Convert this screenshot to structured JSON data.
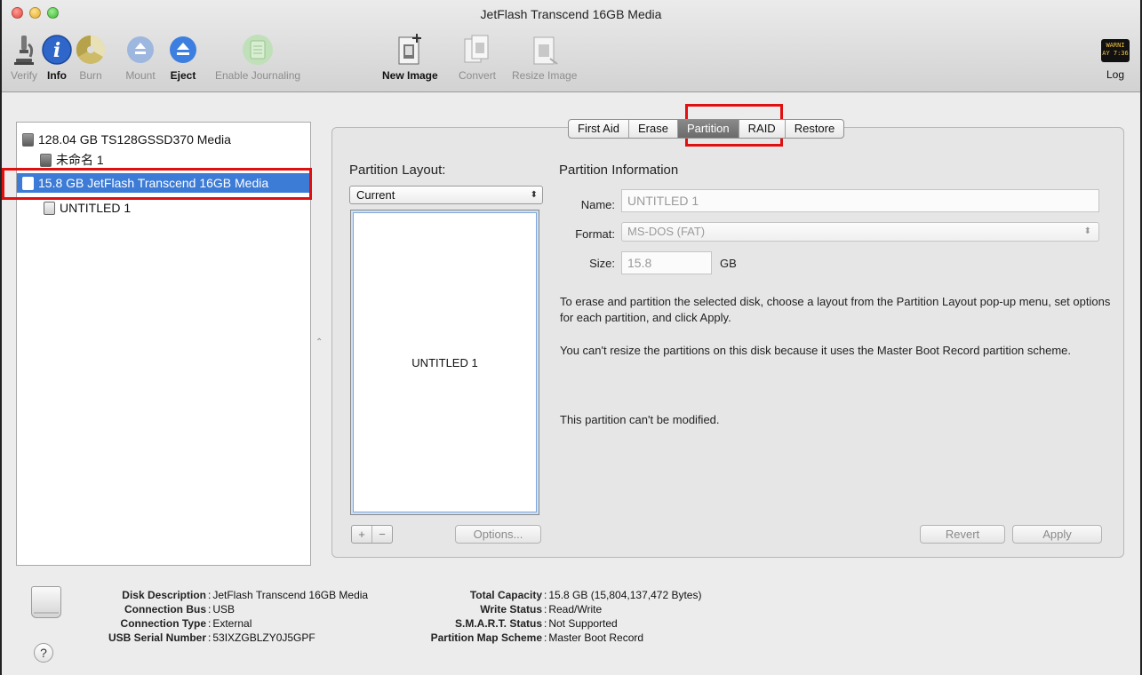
{
  "window": {
    "title": "JetFlash Transcend 16GB Media"
  },
  "toolbar": {
    "items": [
      {
        "label": "Verify",
        "icon": "microscope-icon",
        "enabled": false
      },
      {
        "label": "Info",
        "icon": "info-icon",
        "enabled": true
      },
      {
        "label": "Burn",
        "icon": "burn-icon",
        "enabled": false
      },
      {
        "label": "Mount",
        "icon": "mount-icon",
        "enabled": false
      },
      {
        "label": "Eject",
        "icon": "eject-icon",
        "enabled": true
      },
      {
        "label": "Enable Journaling",
        "icon": "journaling-icon",
        "enabled": false
      },
      {
        "label": "New Image",
        "icon": "new-image-icon",
        "enabled": true
      },
      {
        "label": "Convert",
        "icon": "convert-icon",
        "enabled": false
      },
      {
        "label": "Resize Image",
        "icon": "resize-image-icon",
        "enabled": false
      }
    ],
    "log": {
      "label": "Log",
      "badge_text": "WARNI\nAY 7:36"
    }
  },
  "sidebar": {
    "items": [
      {
        "label": "128.04 GB TS128GSSD370 Media",
        "level": 0
      },
      {
        "label": "未命名 1",
        "level": 1
      },
      {
        "label": "15.8 GB JetFlash Transcend 16GB Media",
        "level": 0,
        "selected": true
      },
      {
        "label": "UNTITLED 1",
        "level": 1
      }
    ]
  },
  "tabs": [
    {
      "label": "First Aid"
    },
    {
      "label": "Erase"
    },
    {
      "label": "Partition",
      "active": true
    },
    {
      "label": "RAID"
    },
    {
      "label": "Restore"
    }
  ],
  "partition": {
    "layout_heading": "Partition Layout:",
    "layout_value": "Current",
    "block_label": "UNTITLED 1",
    "add_label": "+",
    "remove_label": "−",
    "options_label": "Options...",
    "info_heading": "Partition Information",
    "name_label": "Name:",
    "name_value": "UNTITLED 1",
    "format_label": "Format:",
    "format_value": "MS-DOS (FAT)",
    "size_label": "Size:",
    "size_value": "15.8",
    "size_unit": "GB",
    "help_text_1": "To erase and partition the selected disk, choose a layout from the Partition Layout pop-up menu, set options for each partition, and click Apply.",
    "help_text_2": "You can't resize the partitions on this disk because it uses the Master Boot Record partition scheme.",
    "help_text_3": "This partition can't be modified.",
    "revert_label": "Revert",
    "apply_label": "Apply"
  },
  "info": {
    "left": [
      {
        "key": "Disk Description",
        "value": "JetFlash Transcend 16GB Media"
      },
      {
        "key": "Connection Bus",
        "value": "USB"
      },
      {
        "key": "Connection Type",
        "value": "External"
      },
      {
        "key": "USB Serial Number",
        "value": "53IXZGBLZY0J5GPF"
      }
    ],
    "right": [
      {
        "key": "Total Capacity",
        "value": "15.8 GB (15,804,137,472 Bytes)"
      },
      {
        "key": "Write Status",
        "value": "Read/Write"
      },
      {
        "key": "S.M.A.R.T. Status",
        "value": "Not Supported"
      },
      {
        "key": "Partition Map Scheme",
        "value": "Master Boot Record"
      }
    ],
    "separator": ":",
    "help_button": "?"
  }
}
